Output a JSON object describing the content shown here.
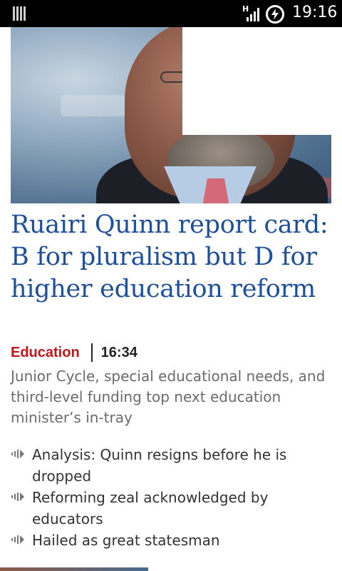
{
  "status_bar": {
    "network_type": "H",
    "time": "19:16"
  },
  "article": {
    "headline": "Ruairi Quinn report card: B for pluralism but D for higher education reform",
    "section": "Education",
    "time": "16:34",
    "standfirst": "Junior Cycle, special educational needs, and third-level funding top next education minister’s in-tray",
    "related": [
      {
        "label": "Analysis: Quinn resigns before he is dropped",
        "icon": "audio-wave-icon"
      },
      {
        "label": "Reforming zeal acknowledged by educators",
        "icon": "audio-wave-icon"
      },
      {
        "label": "Hailed as great statesman",
        "icon": "audio-wave-icon"
      }
    ]
  },
  "colors": {
    "headline": "#1e4f9b",
    "section": "#c0171b",
    "standfirst": "#6b6b6b"
  }
}
